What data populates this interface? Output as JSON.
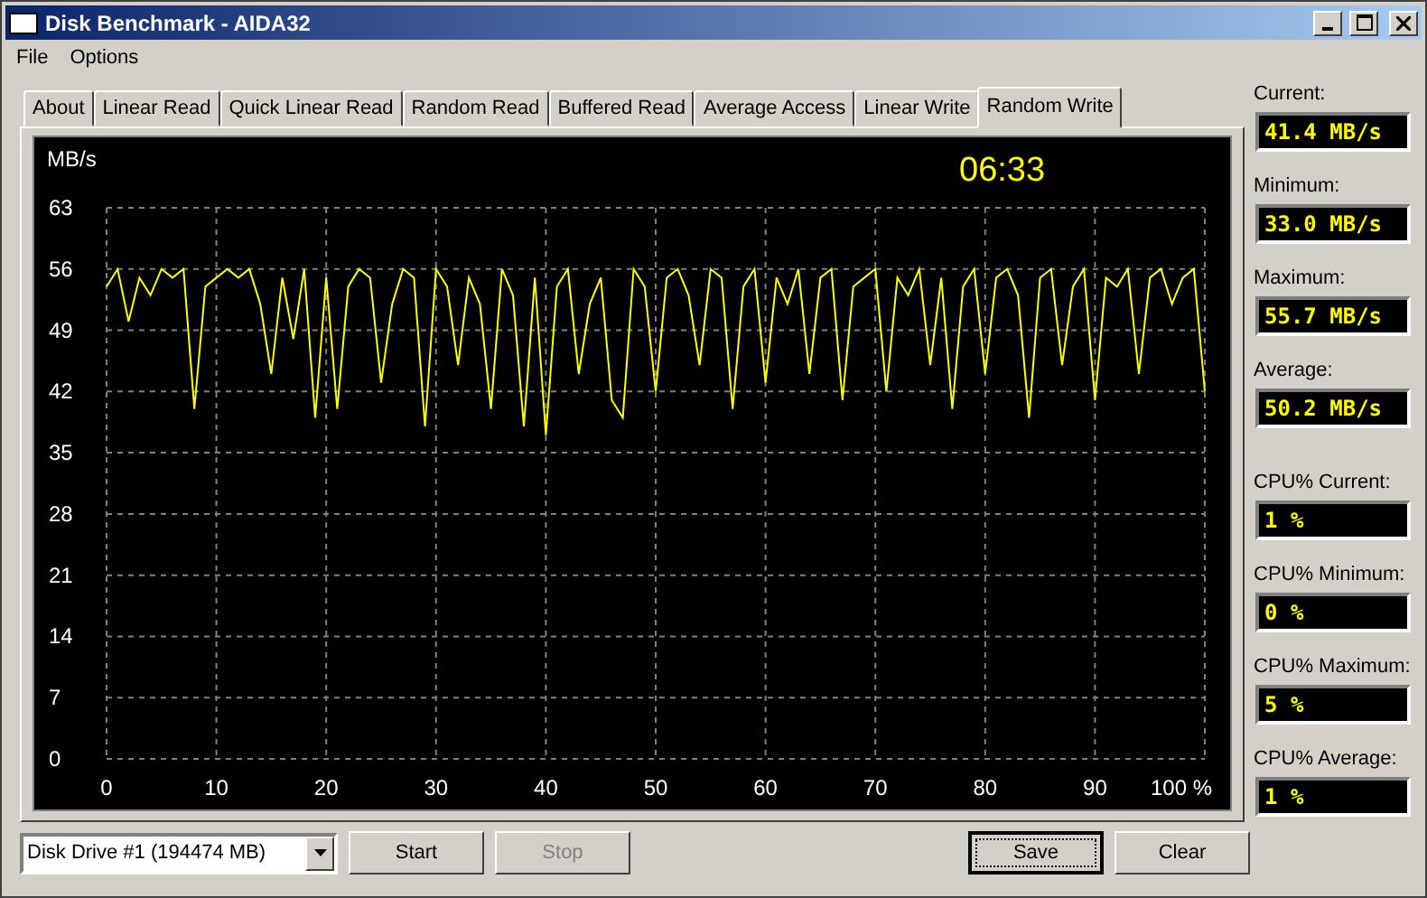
{
  "window": {
    "title": "Disk Benchmark - AIDA32"
  },
  "menu": [
    "File",
    "Options"
  ],
  "tabs": [
    {
      "label": "About",
      "selected": false
    },
    {
      "label": "Linear Read",
      "selected": false
    },
    {
      "label": "Quick Linear Read",
      "selected": false
    },
    {
      "label": "Random Read",
      "selected": false
    },
    {
      "label": "Buffered Read",
      "selected": false
    },
    {
      "label": "Average Access",
      "selected": false
    },
    {
      "label": "Linear Write",
      "selected": false
    },
    {
      "label": "Random Write",
      "selected": true
    }
  ],
  "chart": {
    "timer": "06:33",
    "chart_data": {
      "type": "line",
      "ylabel": "MB/s",
      "grid": true,
      "ylim": [
        0,
        63
      ],
      "xlim": [
        0,
        100
      ],
      "yticks": [
        0,
        7,
        14,
        21,
        28,
        35,
        42,
        49,
        56,
        63
      ],
      "xticks": [
        0,
        10,
        20,
        30,
        40,
        50,
        60,
        70,
        80,
        90,
        {
          "value": 100,
          "label": "100 %"
        }
      ],
      "x": [
        0,
        1,
        2,
        3,
        4,
        5,
        6,
        7,
        8,
        9,
        10,
        11,
        12,
        13,
        14,
        15,
        16,
        17,
        18,
        19,
        20,
        21,
        22,
        23,
        24,
        25,
        26,
        27,
        28,
        29,
        30,
        31,
        32,
        33,
        34,
        35,
        36,
        37,
        38,
        39,
        40,
        41,
        42,
        43,
        44,
        45,
        46,
        47,
        48,
        49,
        50,
        51,
        52,
        53,
        54,
        55,
        56,
        57,
        58,
        59,
        60,
        61,
        62,
        63,
        64,
        65,
        66,
        67,
        68,
        69,
        70,
        71,
        72,
        73,
        74,
        75,
        76,
        77,
        78,
        79,
        80,
        81,
        82,
        83,
        84,
        85,
        86,
        87,
        88,
        89,
        90,
        91,
        92,
        93,
        94,
        95,
        96,
        97,
        98,
        99,
        100
      ],
      "series": [
        {
          "color": "#ffff00",
          "values": [
            54,
            56,
            50,
            55,
            53,
            56,
            55,
            56,
            40,
            54,
            55,
            56,
            55,
            56,
            52,
            44,
            55,
            48,
            56,
            39,
            55,
            40,
            54,
            56,
            55,
            43,
            52,
            56,
            55,
            38,
            56,
            54,
            45,
            55,
            52,
            40,
            56,
            53,
            38,
            55,
            37,
            54,
            56,
            44,
            52,
            55,
            41,
            39,
            56,
            54,
            42,
            55,
            56,
            53,
            45,
            56,
            55,
            40,
            54,
            56,
            43,
            55,
            52,
            56,
            44,
            55,
            56,
            41,
            54,
            55,
            56,
            42,
            55,
            53,
            56,
            45,
            55,
            40,
            54,
            56,
            44,
            55,
            56,
            53,
            39,
            55,
            56,
            45,
            54,
            56,
            41,
            55,
            54,
            56,
            44,
            55,
            56,
            52,
            55,
            56,
            42
          ]
        }
      ]
    }
  },
  "speed_stats": [
    {
      "label": "Current:",
      "value": "41.4 MB/s"
    },
    {
      "label": "Minimum:",
      "value": "33.0 MB/s"
    },
    {
      "label": "Maximum:",
      "value": "55.7 MB/s"
    },
    {
      "label": "Average:",
      "value": "50.2 MB/s"
    }
  ],
  "cpu_stats": [
    {
      "label": "CPU% Current:",
      "value": "1 %"
    },
    {
      "label": "CPU% Minimum:",
      "value": "0 %"
    },
    {
      "label": "CPU% Maximum:",
      "value": "5 %"
    },
    {
      "label": "CPU% Average:",
      "value": "1 %"
    }
  ],
  "drive_select": {
    "value": "Disk Drive #1  (194474 MB)"
  },
  "left_buttons": [
    {
      "label": "Start",
      "disabled": false,
      "default": false
    },
    {
      "label": "Stop",
      "disabled": true,
      "default": false
    }
  ],
  "right_buttons": [
    {
      "label": "Save",
      "disabled": false,
      "default": true
    },
    {
      "label": "Clear",
      "disabled": false,
      "default": false
    }
  ]
}
